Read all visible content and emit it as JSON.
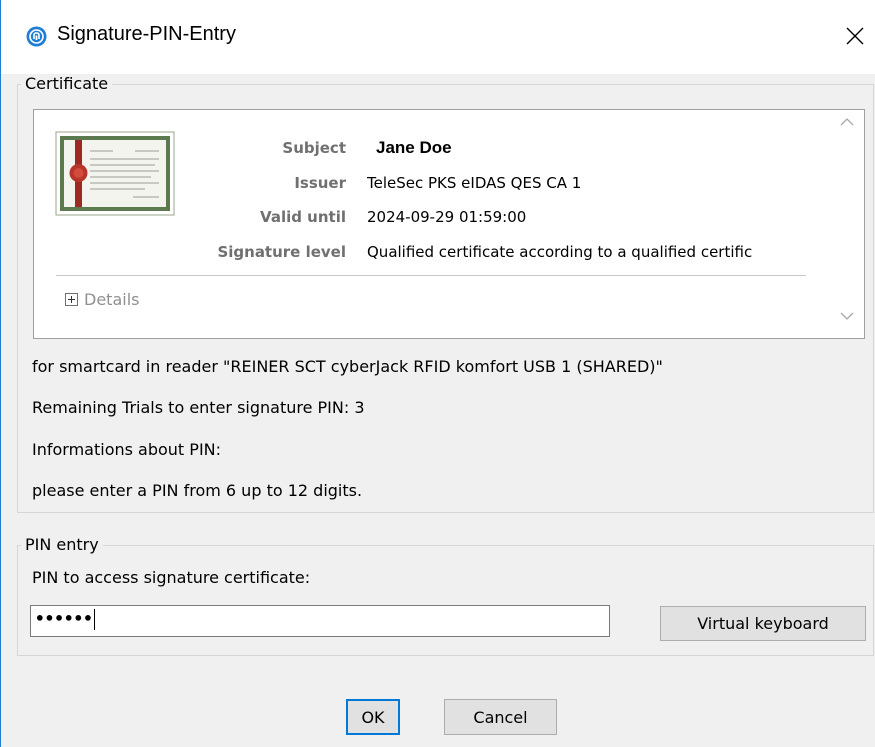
{
  "window": {
    "title": "Signature-PIN-Entry",
    "app_icon": "fingerprint-shield-icon",
    "close_icon": "close-icon"
  },
  "certificate_group": {
    "legend": "Certificate",
    "thumbnail_icon": "certificate-document-icon",
    "fields": [
      {
        "label": "Subject",
        "value": "Jane Doe"
      },
      {
        "label": "Issuer",
        "value": "TeleSec PKS eIDAS QES CA 1"
      },
      {
        "label": "Valid until",
        "value": "2024-09-29 01:59:00"
      },
      {
        "label": "Signature level",
        "value": "Qualified certificate according to a qualified certific"
      }
    ],
    "details_label": "Details"
  },
  "info": {
    "reader_line": "for smartcard in reader \"REINER SCT cyberJack RFID komfort USB 1 (SHARED)\"",
    "remaining_trials": "Remaining Trials to enter signature PIN: 3",
    "informations_about_pin": "Informations about PIN:",
    "pin_hint": "please enter a PIN from 6 up to 12 digits."
  },
  "pin_group": {
    "legend": "PIN entry",
    "field_label": "PIN to access signature certificate:",
    "masked_value": "••••••",
    "virtual_keyboard_label": "Virtual keyboard"
  },
  "buttons": {
    "ok": "OK",
    "cancel": "Cancel"
  },
  "colors": {
    "accent": "#0078d7",
    "title_bar": "#ffffff",
    "dialog_bg": "#f0f0f0"
  }
}
